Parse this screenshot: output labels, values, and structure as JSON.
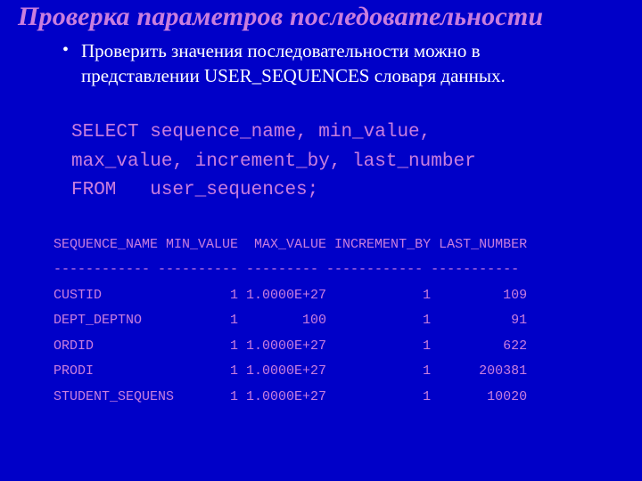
{
  "title": "Проверка параметров последовательности",
  "bullet": "Проверить значения последовательности можно в представлении USER_SEQUENCES словаря данных.",
  "sql": {
    "line1": "SELECT sequence_name, min_value,",
    "line2": "max_value, increment_by, last_number",
    "line3": "FROM   user_sequences;"
  },
  "result": {
    "header": "SEQUENCE_NAME MIN_VALUE  MAX_VALUE INCREMENT_BY LAST_NUMBER",
    "sep": "------------ ---------- --------- ------------ -----------",
    "rows": [
      "CUSTID                1 1.0000E+27            1         109",
      "DEPT_DEPTNO           1        100            1          91",
      "ORDID                 1 1.0000E+27            1         622",
      "PRODI                 1 1.0000E+27            1      200381",
      "STUDENT_SEQUENS       1 1.0000E+27            1       10020"
    ]
  },
  "chart_data": {
    "type": "table",
    "title": "USER_SEQUENCES",
    "columns": [
      "SEQUENCE_NAME",
      "MIN_VALUE",
      "MAX_VALUE",
      "INCREMENT_BY",
      "LAST_NUMBER"
    ],
    "rows": [
      {
        "SEQUENCE_NAME": "CUSTID",
        "MIN_VALUE": 1,
        "MAX_VALUE": "1.0000E+27",
        "INCREMENT_BY": 1,
        "LAST_NUMBER": 109
      },
      {
        "SEQUENCE_NAME": "DEPT_DEPTNO",
        "MIN_VALUE": 1,
        "MAX_VALUE": 100,
        "INCREMENT_BY": 1,
        "LAST_NUMBER": 91
      },
      {
        "SEQUENCE_NAME": "ORDID",
        "MIN_VALUE": 1,
        "MAX_VALUE": "1.0000E+27",
        "INCREMENT_BY": 1,
        "LAST_NUMBER": 622
      },
      {
        "SEQUENCE_NAME": "PRODI",
        "MIN_VALUE": 1,
        "MAX_VALUE": "1.0000E+27",
        "INCREMENT_BY": 1,
        "LAST_NUMBER": 200381
      },
      {
        "SEQUENCE_NAME": "STUDENT_SEQUENS",
        "MIN_VALUE": 1,
        "MAX_VALUE": "1.0000E+27",
        "INCREMENT_BY": 1,
        "LAST_NUMBER": 10020
      }
    ]
  }
}
